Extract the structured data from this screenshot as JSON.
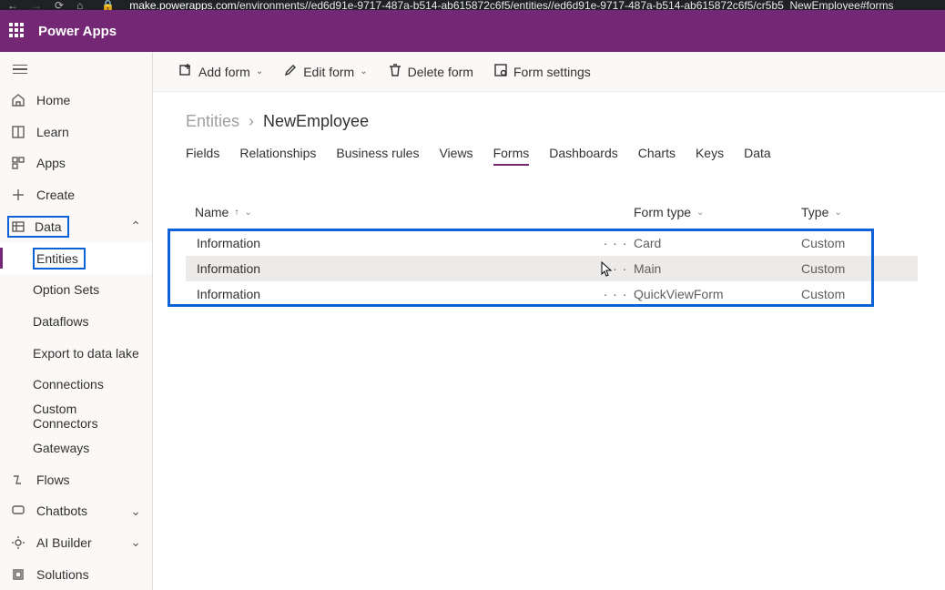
{
  "browser": {
    "url_host": "make.powerapps.com",
    "url_rest": "/environments//ed6d91e-9717-487a-b514-ab615872c6f5/entities//ed6d91e-9717-487a-b514-ab615872c6f5/cr5b5_NewEmployee#forms"
  },
  "header": {
    "app_name": "Power Apps"
  },
  "sidebar": {
    "items": [
      {
        "label": "Home"
      },
      {
        "label": "Learn"
      },
      {
        "label": "Apps"
      },
      {
        "label": "Create"
      },
      {
        "label": "Data"
      },
      {
        "label": "Entities"
      },
      {
        "label": "Option Sets"
      },
      {
        "label": "Dataflows"
      },
      {
        "label": "Export to data lake"
      },
      {
        "label": "Connections"
      },
      {
        "label": "Custom Connectors"
      },
      {
        "label": "Gateways"
      },
      {
        "label": "Flows"
      },
      {
        "label": "Chatbots"
      },
      {
        "label": "AI Builder"
      },
      {
        "label": "Solutions"
      }
    ]
  },
  "commands": {
    "add_form": "Add form",
    "edit_form": "Edit form",
    "delete_form": "Delete form",
    "form_settings": "Form settings"
  },
  "breadcrumb": {
    "root": "Entities",
    "current": "NewEmployee"
  },
  "tabs": {
    "items": [
      "Fields",
      "Relationships",
      "Business rules",
      "Views",
      "Forms",
      "Dashboards",
      "Charts",
      "Keys",
      "Data"
    ],
    "active": "Forms"
  },
  "table": {
    "columns": {
      "name": "Name",
      "form_type": "Form type",
      "type": "Type"
    },
    "rows": [
      {
        "name": "Information",
        "form_type": "Card",
        "type": "Custom"
      },
      {
        "name": "Information",
        "form_type": "Main",
        "type": "Custom"
      },
      {
        "name": "Information",
        "form_type": "QuickViewForm",
        "type": "Custom"
      }
    ]
  }
}
